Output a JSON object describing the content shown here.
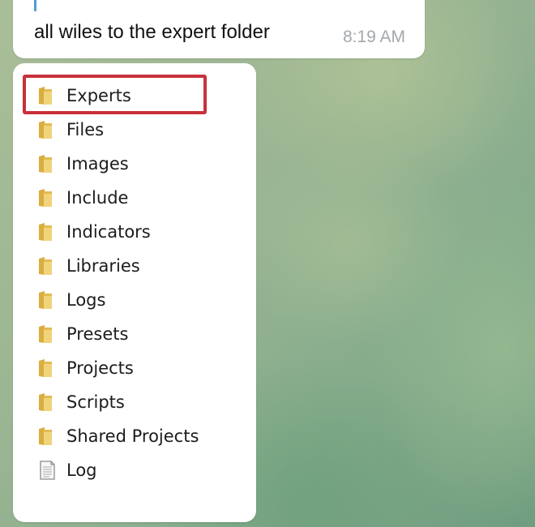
{
  "chat": {
    "text_message": {
      "quote_snippet": "",
      "text": "all wiles to the expert folder",
      "time": "8:19 AM"
    },
    "image_message": {
      "folders": [
        {
          "label": "Experts",
          "type": "folder",
          "highlighted": true
        },
        {
          "label": "Files",
          "type": "folder"
        },
        {
          "label": "Images",
          "type": "folder"
        },
        {
          "label": "Include",
          "type": "folder"
        },
        {
          "label": "Indicators",
          "type": "folder"
        },
        {
          "label": "Libraries",
          "type": "folder"
        },
        {
          "label": "Logs",
          "type": "folder"
        },
        {
          "label": "Presets",
          "type": "folder"
        },
        {
          "label": "Projects",
          "type": "folder"
        },
        {
          "label": "Scripts",
          "type": "folder"
        },
        {
          "label": "Shared Projects",
          "type": "folder"
        },
        {
          "label": "Log",
          "type": "file"
        }
      ],
      "highlight_color": "#c8313a"
    }
  },
  "colors": {
    "quote_bar": "#4a9fd8",
    "time_text": "#a3a8ad",
    "folder_yellow": "#e8c765"
  }
}
